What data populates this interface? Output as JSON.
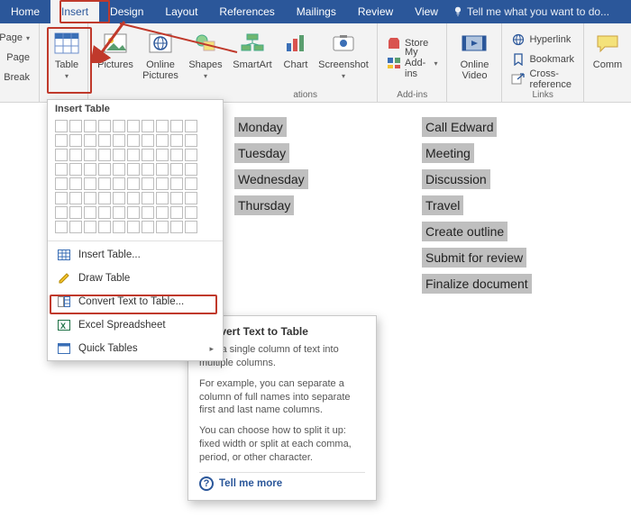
{
  "tabs": {
    "home": "Home",
    "insert": "Insert",
    "design": "Design",
    "layout": "Layout",
    "references": "References",
    "mailings": "Mailings",
    "review": "Review",
    "view": "View",
    "tellme": "Tell me what you want to do..."
  },
  "pages_frag": {
    "page1": "Page",
    "page2": "Page",
    "break": "Break"
  },
  "ribbon": {
    "table": "Table",
    "pictures": "Pictures",
    "online_pictures": "Online Pictures",
    "shapes": "Shapes",
    "smartart": "SmartArt",
    "chart": "Chart",
    "screenshot": "Screenshot",
    "illustrations_label": "ations",
    "store": "Store",
    "myaddins": "My Add-ins",
    "addins_label": "Add-ins",
    "online_video": "Online Video",
    "hyperlink": "Hyperlink",
    "bookmark": "Bookmark",
    "crossref": "Cross-reference",
    "links_label": "Links",
    "comm": "Comm"
  },
  "dd": {
    "title": "Insert Table",
    "insert_table": "Insert Table...",
    "draw_table": "Draw Table",
    "convert": "Convert Text to Table...",
    "excel": "Excel Spreadsheet",
    "quick": "Quick Tables"
  },
  "tooltip": {
    "title": "Convert Text to Table",
    "p1": "Split a single column of text into multiple columns.",
    "p2": "For example, you can separate a column of full names into separate first and last name columns.",
    "p3": "You can choose how to split it up: fixed width or split at each comma, period, or other character.",
    "tellmore": "Tell me more"
  },
  "doc": {
    "rows": [
      {
        "c1": "Monday",
        "c2": "Call Edward"
      },
      {
        "c1": "Tuesday",
        "c2": "Meeting"
      },
      {
        "c1": "Wednesday",
        "c2": "Discussion"
      },
      {
        "c1": "Thursday",
        "c2": "Travel"
      },
      {
        "c1": "",
        "c2": "Create outline"
      },
      {
        "c1": "",
        "c2": "Submit for review"
      },
      {
        "c1": "",
        "c2": "Finalize document"
      }
    ]
  }
}
